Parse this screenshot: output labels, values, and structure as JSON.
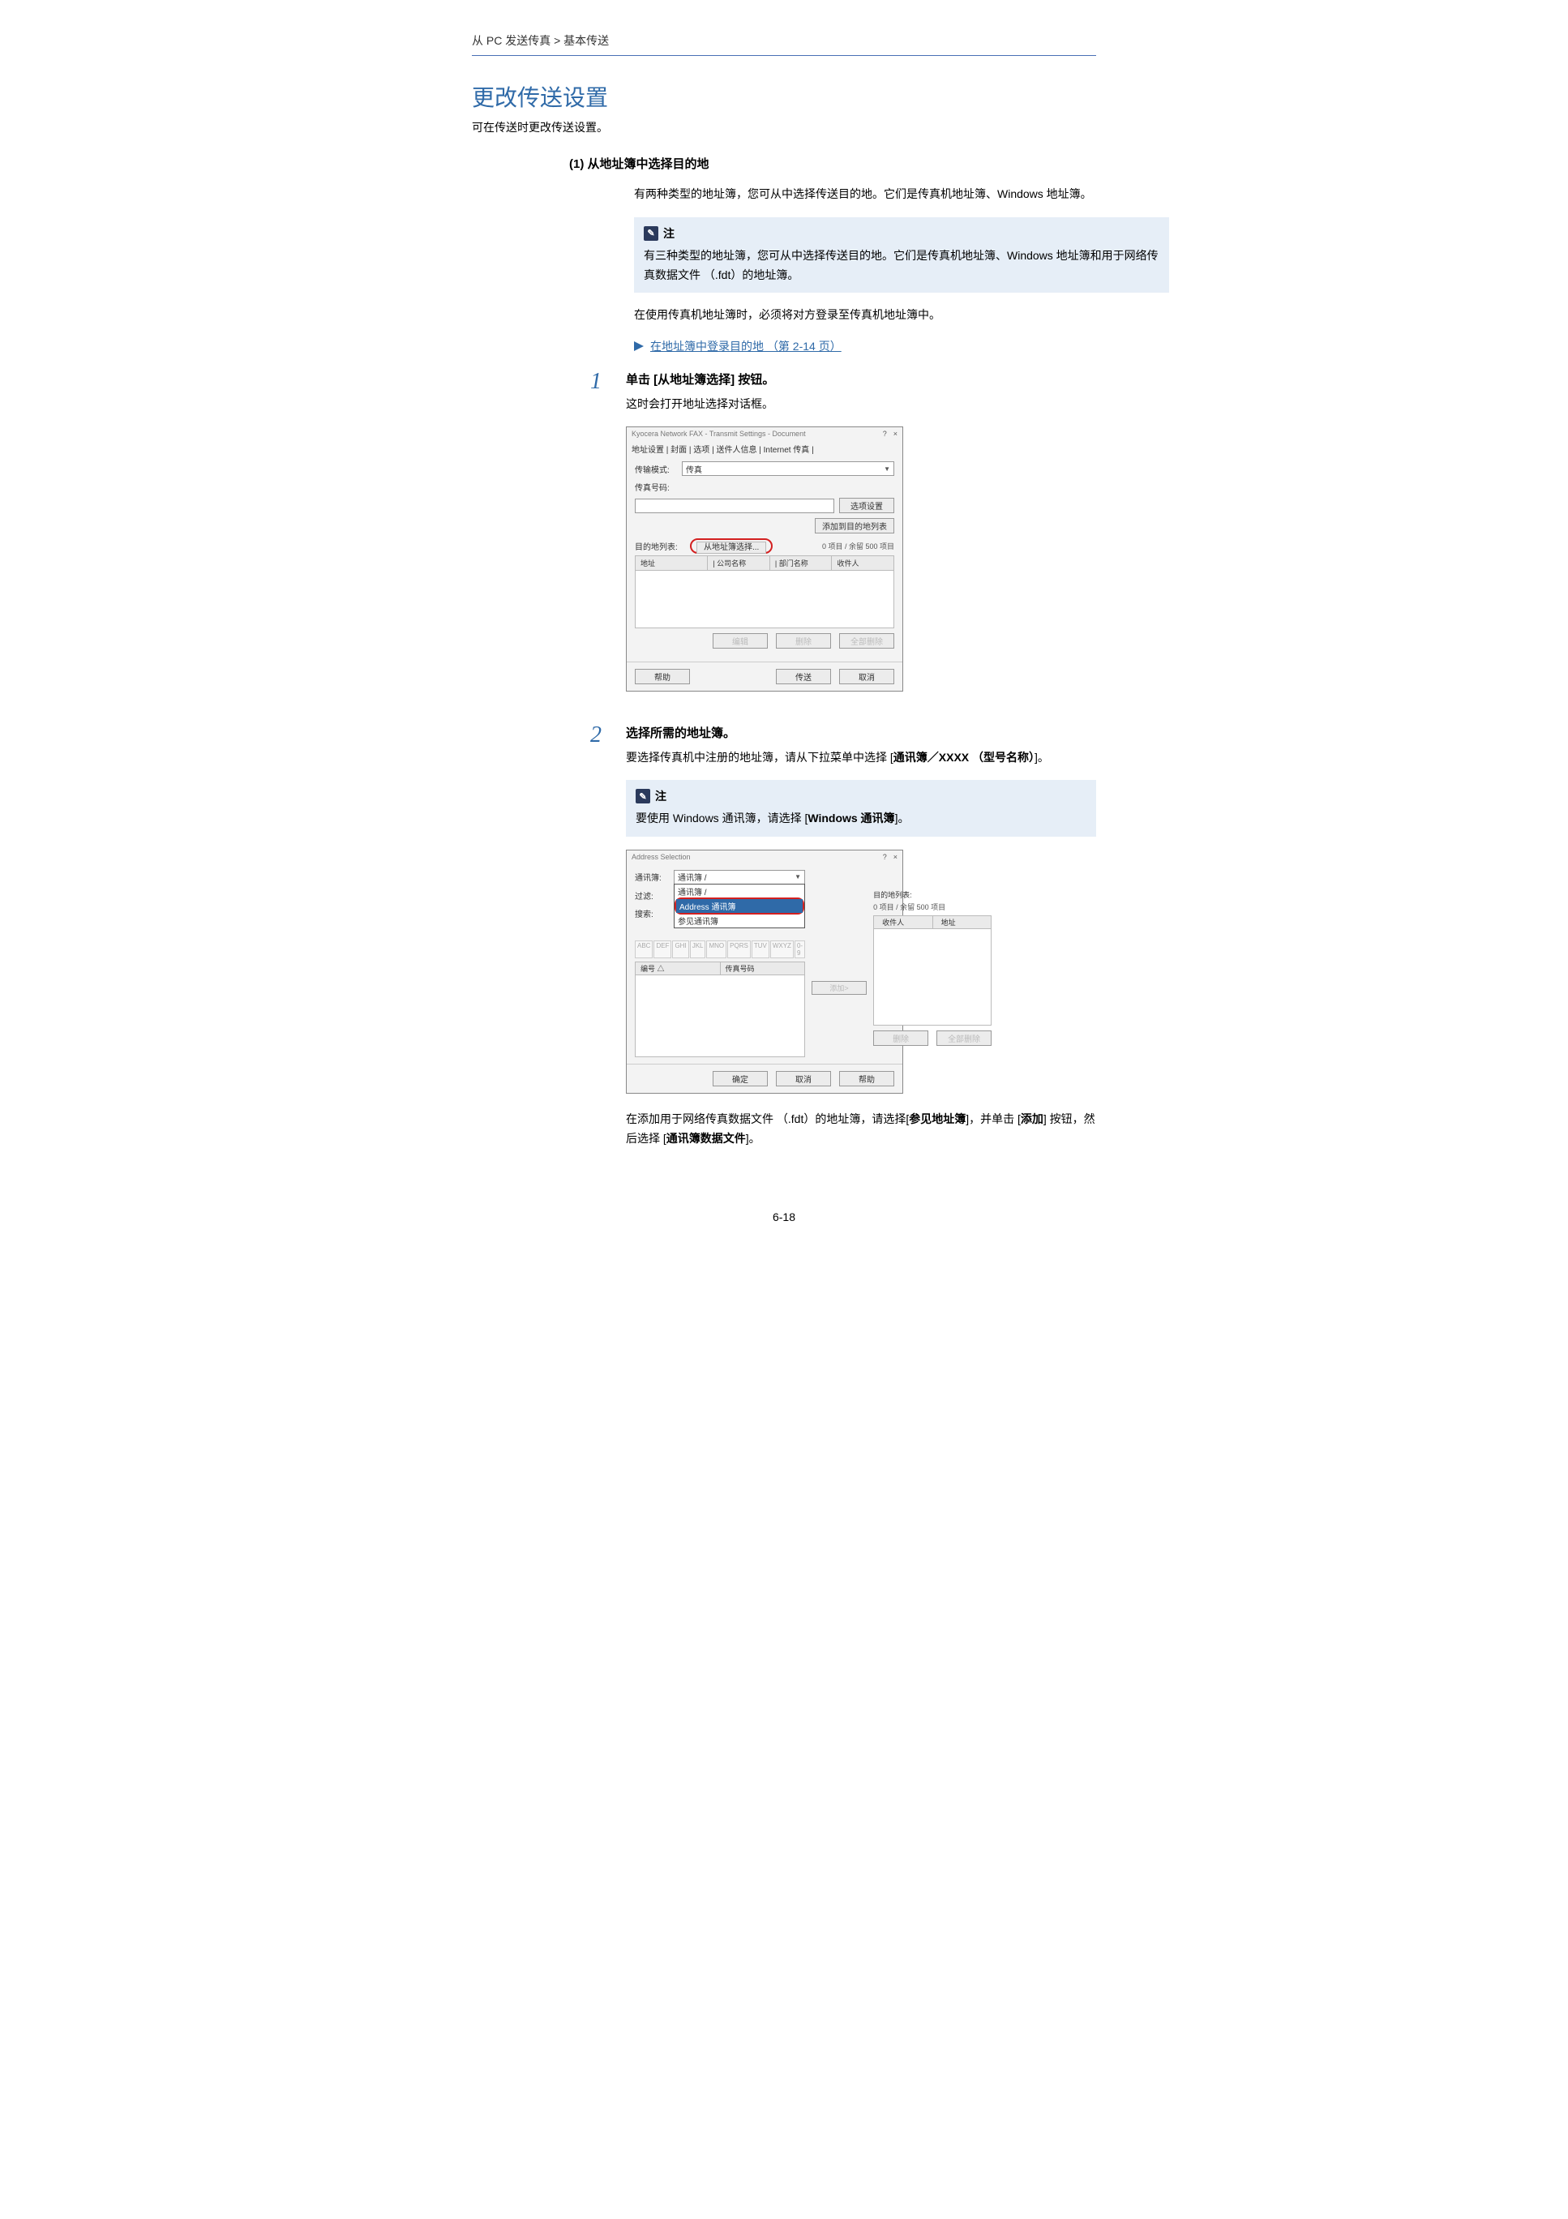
{
  "breadcrumb": "从 PC 发送传真 > 基本传送",
  "title": "更改传送设置",
  "subtitle": "可在传送时更改传送设置。",
  "section1_head": "(1) 从地址簿中选择目的地",
  "section1_para": "有两种类型的地址簿，您可从中选择传送目的地。它们是传真机地址簿、Windows 地址簿。",
  "note1_label": "注",
  "note1_body": "有三种类型的地址簿，您可从中选择传送目的地。它们是传真机地址簿、Windows 地址簿和用于网络传真数据文件 （.fdt）的地址簿。",
  "para_after_note1": "在使用传真机地址簿时，必须将对方登录至传真机地址簿中。",
  "link_text": "在地址簿中登录目的地 （第 2-14 页）",
  "step1_title": "单击 [从地址簿选择] 按钮。",
  "step1_desc": "这时会打开地址选择对话框。",
  "step2_title": "选择所需的地址簿。",
  "step2_desc_pre": "要选择传真机中注册的地址簿，请从下拉菜单中选择 [",
  "step2_desc_bold": "通讯簿／XXXX （型号名称）",
  "step2_desc_post": "]。",
  "note2_label": "注",
  "note2_body_pre": "要使用 Windows 通讯簿，请选择 [",
  "note2_body_bold": "Windows 通讯簿",
  "note2_body_post": "]。",
  "para_final_1a": "在添加用于网络传真数据文件 （.fdt）的地址簿，请选择[",
  "para_final_1b": "参见地址簿",
  "para_final_1c": "]，并单击 [",
  "para_final_1d": "添加",
  "para_final_1e": "] 按钮，然后选择 [",
  "para_final_1f": "通讯簿数据文件",
  "para_final_1g": "]。",
  "page_num": "6-18",
  "dlg1": {
    "title": "Kyocera Network FAX - Transmit Settings - Document",
    "help_q": "?",
    "close_x": "×",
    "tabs": "地址设置 | 封面 | 选项 | 送件人信息 | Internet 传真 |",
    "mode_label": "传输模式:",
    "mode_value": "传真",
    "faxno_label": "传真号码:",
    "opt_btn": "选项设置",
    "add_btn": "添加到目的地列表",
    "dest_label": "目的地列表:",
    "select_btn": "从地址簿选择...",
    "count": "0 项目 / 余留 500 项目",
    "col_addr": "地址",
    "col_company": "| 公司名称",
    "col_dept": "| 部门名称",
    "col_recip": "收件人",
    "edit_btn": "编辑",
    "del_btn": "删除",
    "delall_btn": "全部删除",
    "help_btn": "帮助",
    "send_btn": "传送",
    "cancel_btn": "取消"
  },
  "dlg2": {
    "title": "Address Selection",
    "help_q": "?",
    "close_x": "×",
    "book_label": "通讯簿:",
    "book_value": "通讯簿 /",
    "dd_item1": "通讯簿 /",
    "dd_item2": "Address 通讯簿",
    "dd_item3": "参见通讯簿",
    "filter_label": "过滤:",
    "search_label": "搜索:",
    "alpha": [
      "ABC",
      "DEF",
      "GHI",
      "JKL",
      "MNO",
      "PQRS",
      "TUV",
      "WXYZ",
      "0-9"
    ],
    "col_no": "编号 △",
    "col_fax": "传真号码",
    "add_mid": "添加>",
    "right_head": "目的地列表:",
    "right_count": "0 项目 / 余留 500 项目",
    "col_recip": "收件人",
    "col_addr": "地址",
    "r_del": "删除",
    "r_delall": "全部删除",
    "ok_btn": "确定",
    "cancel_btn": "取消",
    "help_btn": "帮助"
  }
}
